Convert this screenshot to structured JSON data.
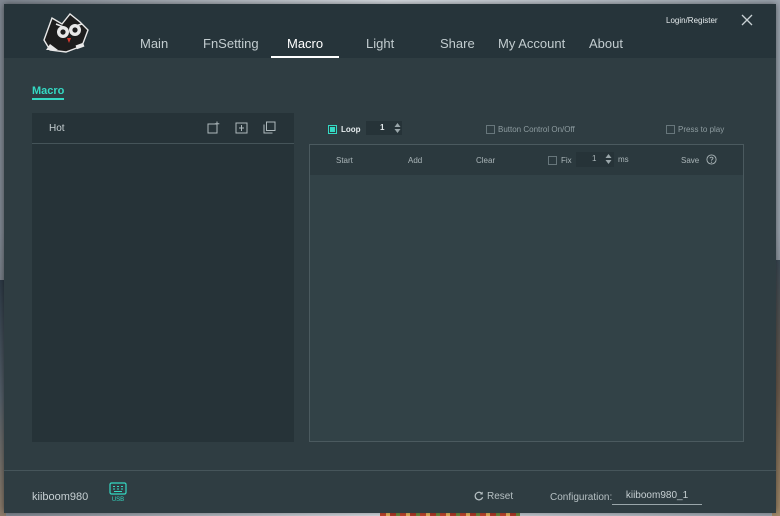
{
  "header": {
    "nav": [
      {
        "label": "Main"
      },
      {
        "label": "FnSetting"
      },
      {
        "label": "Macro",
        "active": true
      },
      {
        "label": "Light"
      },
      {
        "label": "Share"
      },
      {
        "label": "My Account"
      },
      {
        "label": "About"
      }
    ],
    "login_label": "Login/Register"
  },
  "section_title": "Macro",
  "macro_list": {
    "header_label": "Hot",
    "icons": [
      "new-macro-icon",
      "import-icon",
      "copy-icon"
    ]
  },
  "options": {
    "loop": {
      "label": "Loop",
      "checked": true,
      "count": "1"
    },
    "button_control": {
      "label": "Button Control On/Off",
      "checked": false
    },
    "press_to_play": {
      "label": "Press to play",
      "checked": false
    }
  },
  "editor_toolbar": {
    "start_label": "Start",
    "add_label": "Add",
    "clear_label": "Clear",
    "fix_label": "Fix",
    "fix_checked": false,
    "fix_value": "1",
    "fix_unit": "ms",
    "save_label": "Save"
  },
  "footer": {
    "device_name": "kiiboom980",
    "usb_label": "USB",
    "reset_label": "Reset",
    "configuration_label": "Configuration:",
    "configuration_value": "kiiboom980_1"
  },
  "colors": {
    "accent": "#34d9c3",
    "window_bg": "#2f3d42",
    "header_bg": "#26343a",
    "panel_bg": "#263338"
  }
}
